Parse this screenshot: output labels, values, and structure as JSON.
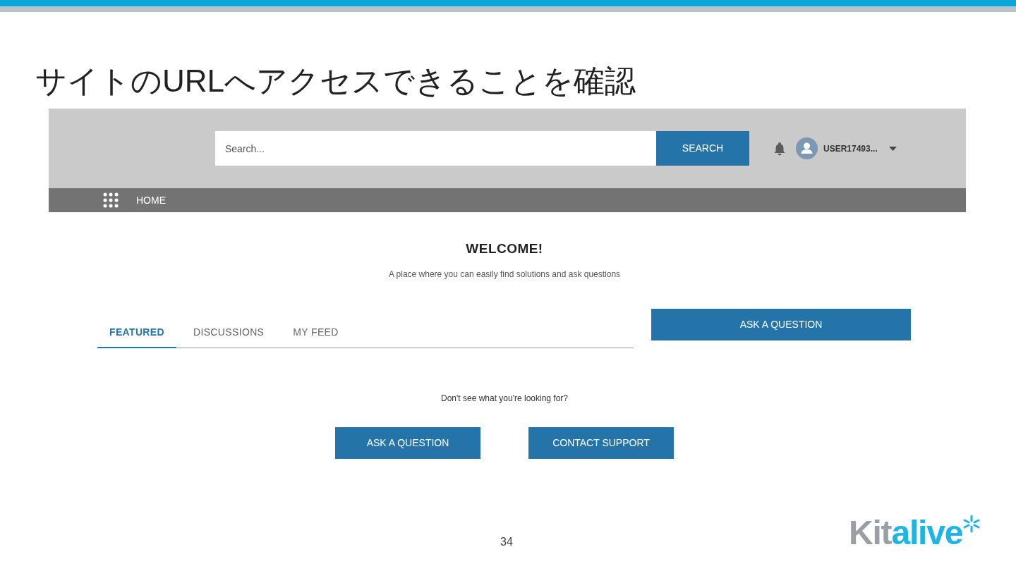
{
  "slide": {
    "title": "サイトのURLへアクセスできることを確認",
    "page_number": "34",
    "logo": {
      "prefix": "Kit",
      "suffix": "alive"
    }
  },
  "header": {
    "search": {
      "placeholder": "Search...",
      "button": "SEARCH"
    },
    "user": {
      "name": "USER17493..."
    }
  },
  "nav": {
    "items": [
      {
        "label": "HOME"
      }
    ]
  },
  "welcome": {
    "heading": "WELCOME!",
    "subtitle": "A place where you can easily find solutions and ask questions"
  },
  "tabs": [
    {
      "label": "FEATURED",
      "selected": true
    },
    {
      "label": "DISCUSSIONS",
      "selected": false
    },
    {
      "label": "MY FEED",
      "selected": false
    }
  ],
  "ask_button": "ASK A QUESTION",
  "help": {
    "prompt": "Don't see what you're looking for?",
    "buttons": [
      "ASK A QUESTION",
      "CONTACT SUPPORT"
    ]
  }
}
